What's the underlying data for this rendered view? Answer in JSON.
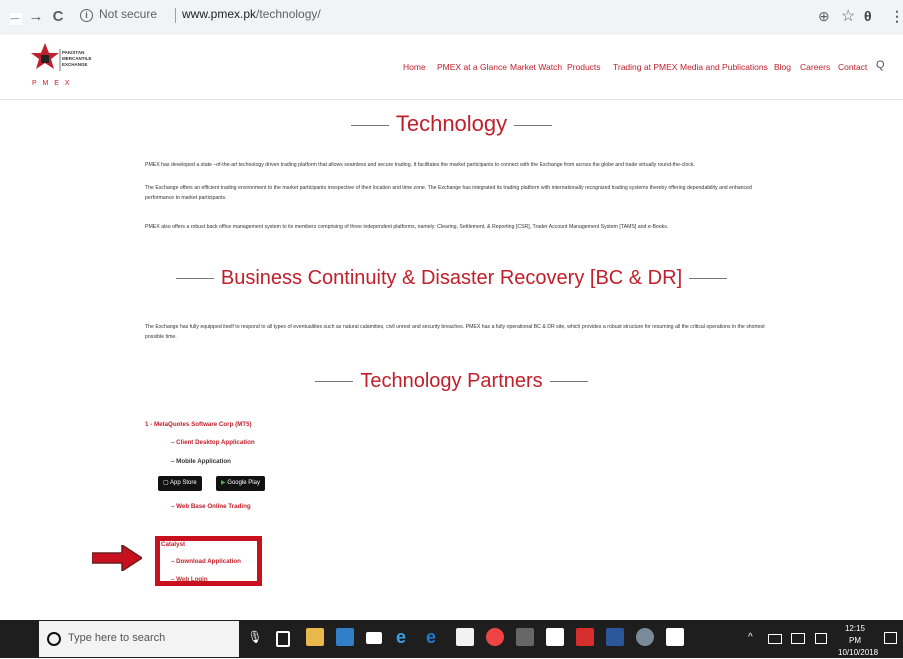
{
  "browser": {
    "back": "←",
    "forward": "→",
    "reload": "C",
    "security": "Not secure",
    "url_domain": "www.pmex.pk",
    "url_path": "/technology/",
    "info_glyph": "i",
    "zoom_icon": "⊕",
    "star_icon": "☆",
    "account_icon": "θ",
    "menu_icon": "⋮"
  },
  "site": {
    "logo_lines": [
      "PAKISTAN",
      "MERCANTILE",
      "EXCHANGE"
    ],
    "logo_pmex": "P M E X",
    "nav": [
      "Home",
      "PMEX at a Glance",
      "Market Watch",
      "Products",
      "Trading at PMEX",
      "Media and Publications",
      "Blog",
      "Careers",
      "Contact"
    ],
    "search_icon": "Q"
  },
  "sections": {
    "technology": {
      "title": "Technology",
      "paragraphs": [
        "PMEX has developed a state –of-the-art technology driven trading platform that allows seamless and secure trading. It facilitates the market participants to connect with the Exchange from across the globe and trade virtually round-the-clock.",
        "The Exchange offers an efficient trading environment to the market participants irrespective of their location and time zone.  The Exchange has integrated its trading platform with internationally recognized trading systems thereby offering dependability and enhanced performance to market participants.",
        "PMEX also offers a robust back office management system to its members comprising of three independent platforms, namely: Clearing, Settlement, & Reporting [CSR], Trader Account Management System [TAMS] and e-Books."
      ]
    },
    "bcdr": {
      "title": "Business Continuity & Disaster Recovery [BC & DR]",
      "paragraph": "The Exchange has fully equipped itself to respond to all types of eventualities such as natural calamities, civil unrest and security breaches. PMEX has a fully operational BC & DR site, which provides a robust structure for resuming all the critical operations in the shortest possible time."
    },
    "partners": {
      "title": "Technology Partners",
      "item1": "1 - MetaQuotes Software Corp (MT5)",
      "client_desktop": "– Client Desktop Application",
      "mobile": "– Mobile Application",
      "app_store": "App Store",
      "google_play": "Google Play",
      "web_trading": "– Web Base Online Trading",
      "catalyst": "Catalyst",
      "download": "– Download Application",
      "web_login": "– Web Login"
    }
  },
  "taskbar": {
    "search_placeholder": "Type here to search",
    "time": "12:15 PM",
    "date": "10/10/2018",
    "tray_up": "^"
  },
  "colors": {
    "brand_red": "#c0202b",
    "highlight_red": "#c8101e",
    "taskbar": "#1e1e1e"
  }
}
